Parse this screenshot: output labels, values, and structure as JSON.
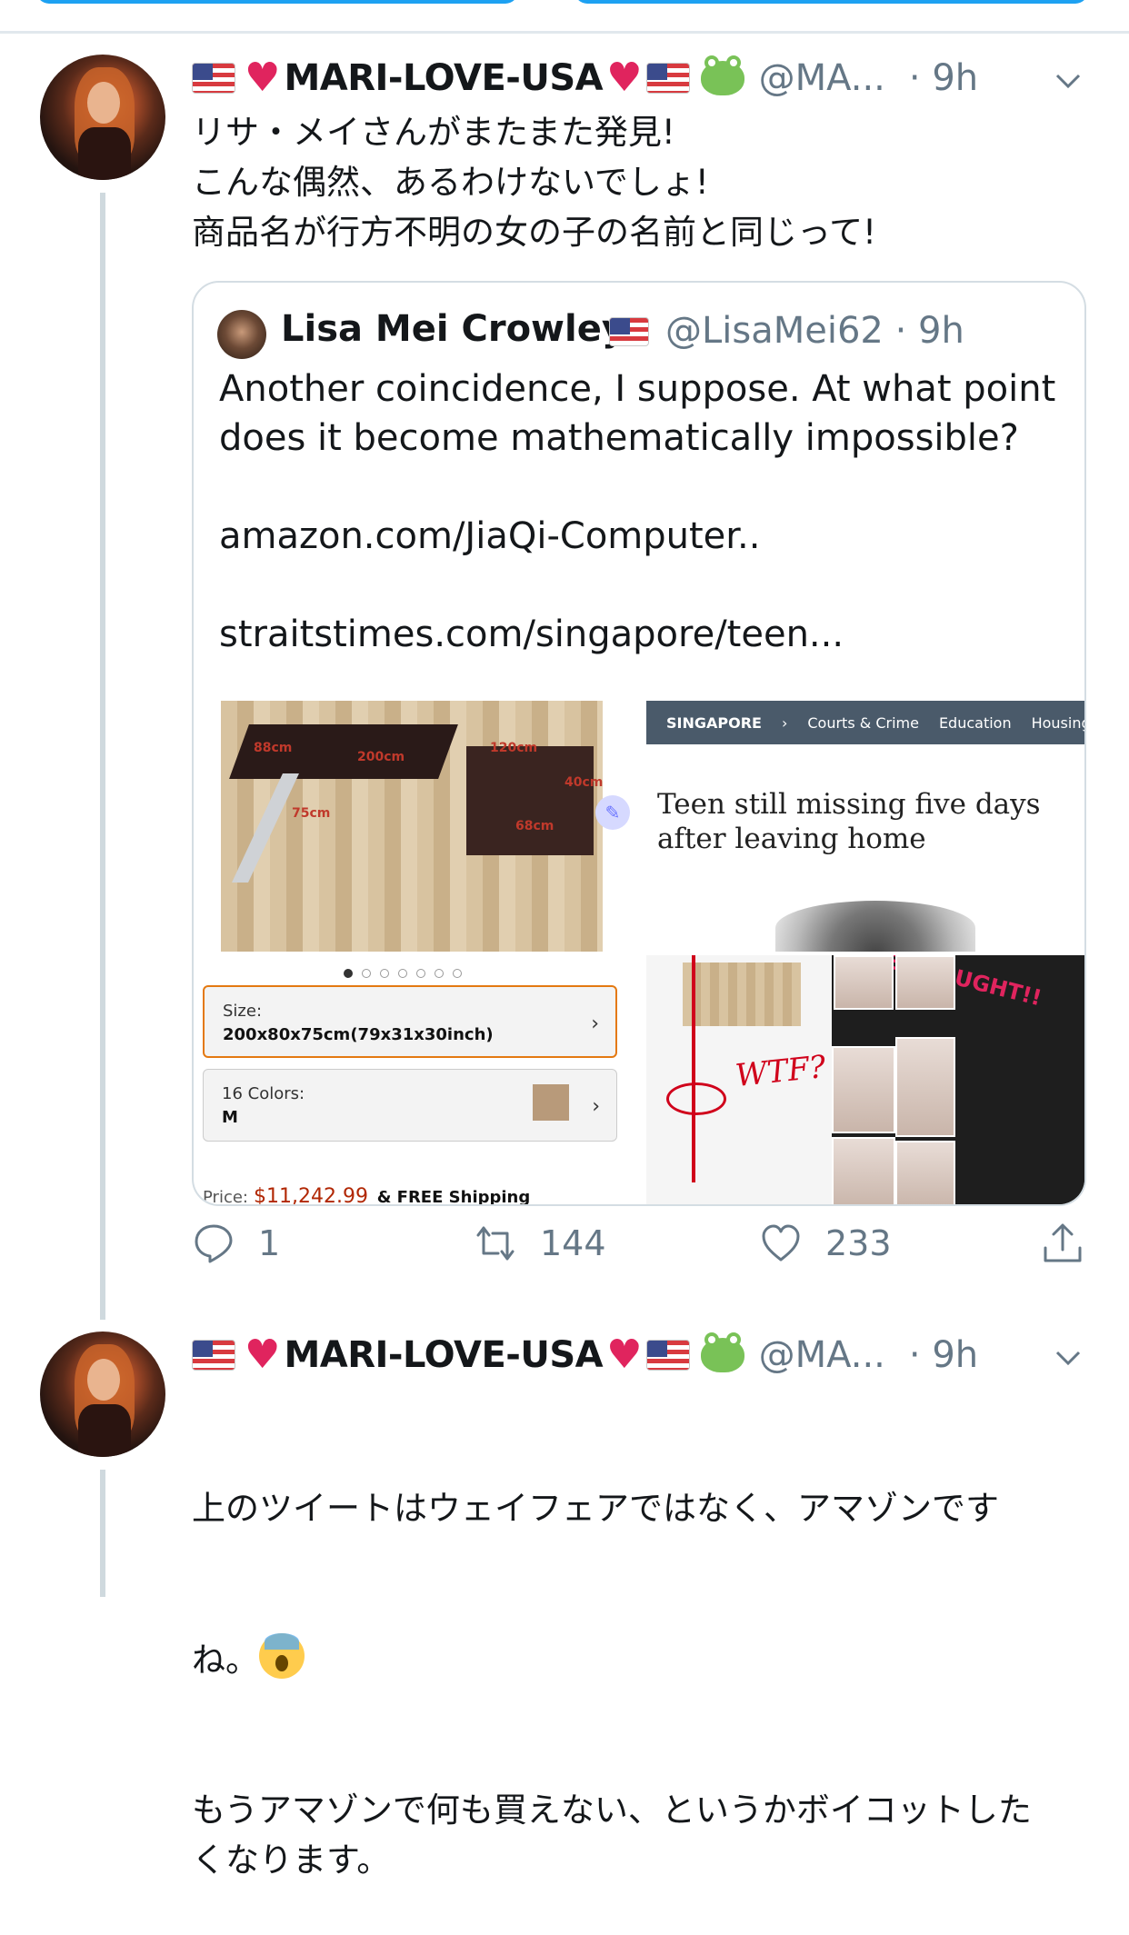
{
  "tweet1": {
    "display_name": "MARI-LOVE-USA",
    "handle": "@MA...",
    "time": "· 9h",
    "text": "リサ・メイさんがまたまた発見!\nこんな偶然、あるわけないでしょ!\n商品名が行方不明の女の子の名前と同じって!"
  },
  "quote": {
    "display_name": "Lisa Mei Crowley",
    "handle_time": "@LisaMei62 · 9h",
    "text": "Another coincidence, I suppose. At what point does it become mathematically impossible?\n\namazon.com/JiaQi-Computer..\n\nstraitstimes.com/singapore/teen..."
  },
  "product": {
    "dimensions": [
      "88cm",
      "200cm",
      "120cm",
      "40cm",
      "75cm",
      "68cm"
    ],
    "size_label": "Size:",
    "size_value": "200x80x75cm(79x31x30inch)",
    "colors_label": "16 Colors:",
    "colors_value": "M",
    "price_label": "Price:",
    "price_amount": "$11,242.99",
    "price_shipping": "& FREE Shipping"
  },
  "article": {
    "nav": [
      "SINGAPORE",
      "›",
      "Courts & Crime",
      "Education",
      "Housing"
    ],
    "headline": "Teen still missing five days after leaving home"
  },
  "collage": {
    "wtf": "WTF?",
    "caught": "BEEN CAUGHT!!"
  },
  "actions": {
    "replies": "1",
    "retweets": "144",
    "likes": "233"
  },
  "tweet2": {
    "display_name": "MARI-LOVE-USA",
    "handle": "@MA...",
    "time": "· 9h",
    "text_line1": "上のツイートはウェイフェアではなく、アマゾンです",
    "text_line2": "ね。",
    "text_rest": "もうアマゾンで何も買えない、というかボイコットした\nくなります。"
  },
  "icons": {
    "reply": "reply-icon",
    "retweet": "retweet-icon",
    "like": "heart-icon",
    "share": "share-icon",
    "caret": "chevron-down-icon"
  },
  "colors": {
    "accent": "#1da1f2",
    "secondary_text": "#657786",
    "heart": "#e0245e",
    "price": "#b12704"
  }
}
